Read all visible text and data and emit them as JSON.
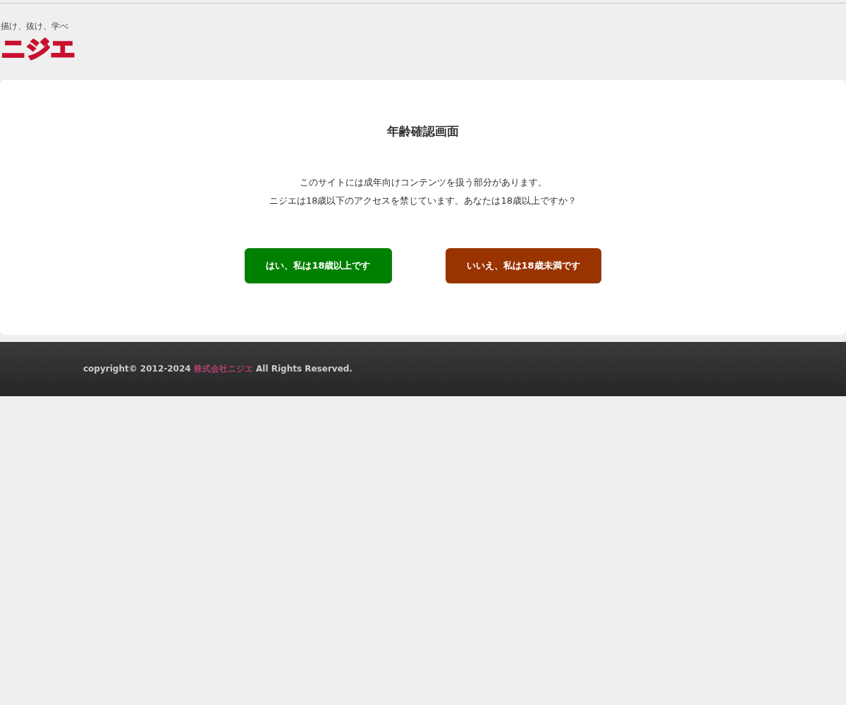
{
  "header": {
    "tagline": "描け、抜け、学べ",
    "logo": "ニジエ"
  },
  "card": {
    "title": "年齢確認画面",
    "message": [
      "このサイトには成年向けコンテンツを扱う部分があります。",
      "ニジエは18歳以下のアクセスを禁じています。あなたは18歳以上ですか？"
    ],
    "buttons": [
      {
        "label": "はい、私は18歳以上です",
        "kind": "confirm"
      },
      {
        "label": "いいえ、私は18歳未満です",
        "kind": "deny"
      }
    ]
  },
  "footer": {
    "prefix": "copyright© 2012-2024 ",
    "link": "株式会社ニジエ",
    "suffix": " All Rights Reserved."
  }
}
